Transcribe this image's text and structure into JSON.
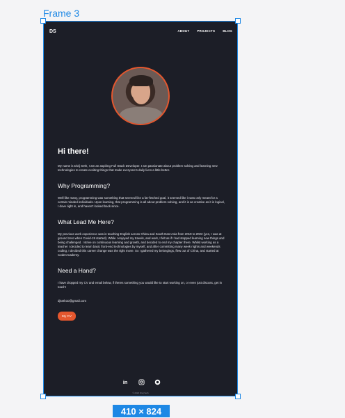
{
  "canvas": {
    "frame_label": "Frame 3",
    "size_badge": "410 × 824"
  },
  "header": {
    "logo": "DS",
    "nav": [
      "ABOUT",
      "PROJECTS",
      "BLOG"
    ]
  },
  "hero": {
    "avatar_icon": "profile-photo"
  },
  "sections": {
    "greeting": "Hi there!",
    "intro": "My name is Divij Seth, I am an aspiring Full Stack Developer. I am passionate about problem solving and learning new technologies to create exciting things that make everyone's daily lives a little better.",
    "why_title": "Why Programming?",
    "why_text": "Well like many, programming was something that seemed like a far-fetched goal, it seemed like it was only meant for a certain minded individuals. Upon learning, that programming is all about problem solving, and it is as creative as it is logical, I dove right in, and haven't looked back since.",
    "lead_title": "What Lead Me Here?",
    "lead_text": "My previous work experience was in teaching English across China and South East Asia from 2019 to 2022 (yes, I was at ground zero when Covid-19 started). While I enjoyed my travels, and work, I felt as if I had stopped learning new things and being challenged. I strive on continuous learning and growth, and decided to end my chapter there. Whilst working as a teacher I decided to learn basic front-end technologies by myself, and after committing many week nights and weekends coding, I decided this career change was the right move. So I gathered my belongings, flew out of China, and started at CoderAcademy.",
    "hand_title": "Need a Hand?",
    "hand_text": "I have dropped my CV and email below, if theres something you would like to start working on, or even just discuss, get in touch!",
    "email": "djseth10@gmail.com",
    "cv_button": "My CV"
  },
  "social": {
    "icons": [
      "linkedin-icon",
      "instagram-icon",
      "github-icon"
    ]
  },
  "footer": {
    "text": "© 2023 Divij Seth"
  },
  "colors": {
    "accent": "#e4572e",
    "background": "#1c1e27",
    "selection": "#1e88e5"
  }
}
